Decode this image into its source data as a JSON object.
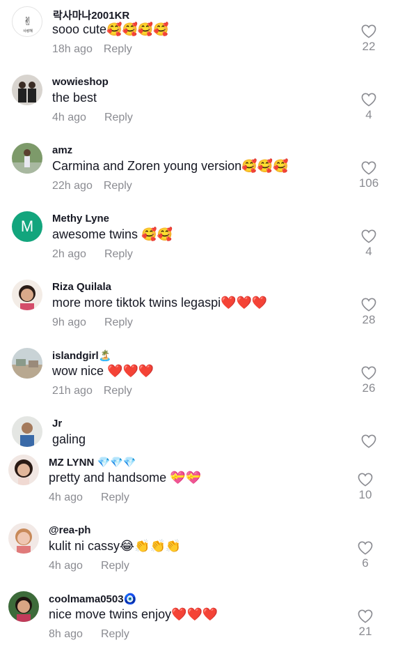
{
  "comments": [
    {
      "username": "락사마나2001KR",
      "text": "sooo cute🥰🥰🥰🥰",
      "time": "18h ago",
      "reply": "Reply",
      "likes": "22"
    },
    {
      "username": "wowieshop",
      "text": "the best",
      "time": "4h ago",
      "reply": "Reply",
      "likes": "4"
    },
    {
      "username": "amz",
      "text": "Carmina and Zoren young version🥰🥰🥰",
      "time": "22h ago",
      "reply": "Reply",
      "likes": "106"
    },
    {
      "username": "Methy Lyne",
      "text": "awesome twins 🥰🥰",
      "time": "2h ago",
      "reply": "Reply",
      "likes": "4",
      "avatar_letter": "M"
    },
    {
      "username": "Riza Quilala",
      "text": "more more tiktok twins legaspi❤️❤️❤️",
      "time": "9h ago",
      "reply": "Reply",
      "likes": "28"
    },
    {
      "username": "islandgirl🏝️",
      "text": "wow nice ❤️❤️❤️",
      "time": "21h ago",
      "reply": "Reply",
      "likes": "26"
    },
    {
      "username": "Jr",
      "text": "galing",
      "time": "",
      "reply": "",
      "likes": ""
    },
    {
      "username": "MZ LYNN 💎💎💎",
      "text": "pretty and handsome 💝💝",
      "time": "4h ago",
      "reply": "Reply",
      "likes": "10"
    },
    {
      "username": "@rea-ph",
      "text": "kulit ni cassy😂👏👏👏",
      "time": "4h ago",
      "reply": "Reply",
      "likes": "6"
    },
    {
      "username": "coolmama0503🧿",
      "text": "nice move twins enjoy❤️❤️❤️",
      "time": "8h ago",
      "reply": "Reply",
      "likes": "21"
    }
  ],
  "colors": {
    "text": "#161823",
    "muted": "#8a8b91",
    "avatar_green": "#13a57d"
  },
  "icons": {
    "like": "heart-outline-icon"
  }
}
